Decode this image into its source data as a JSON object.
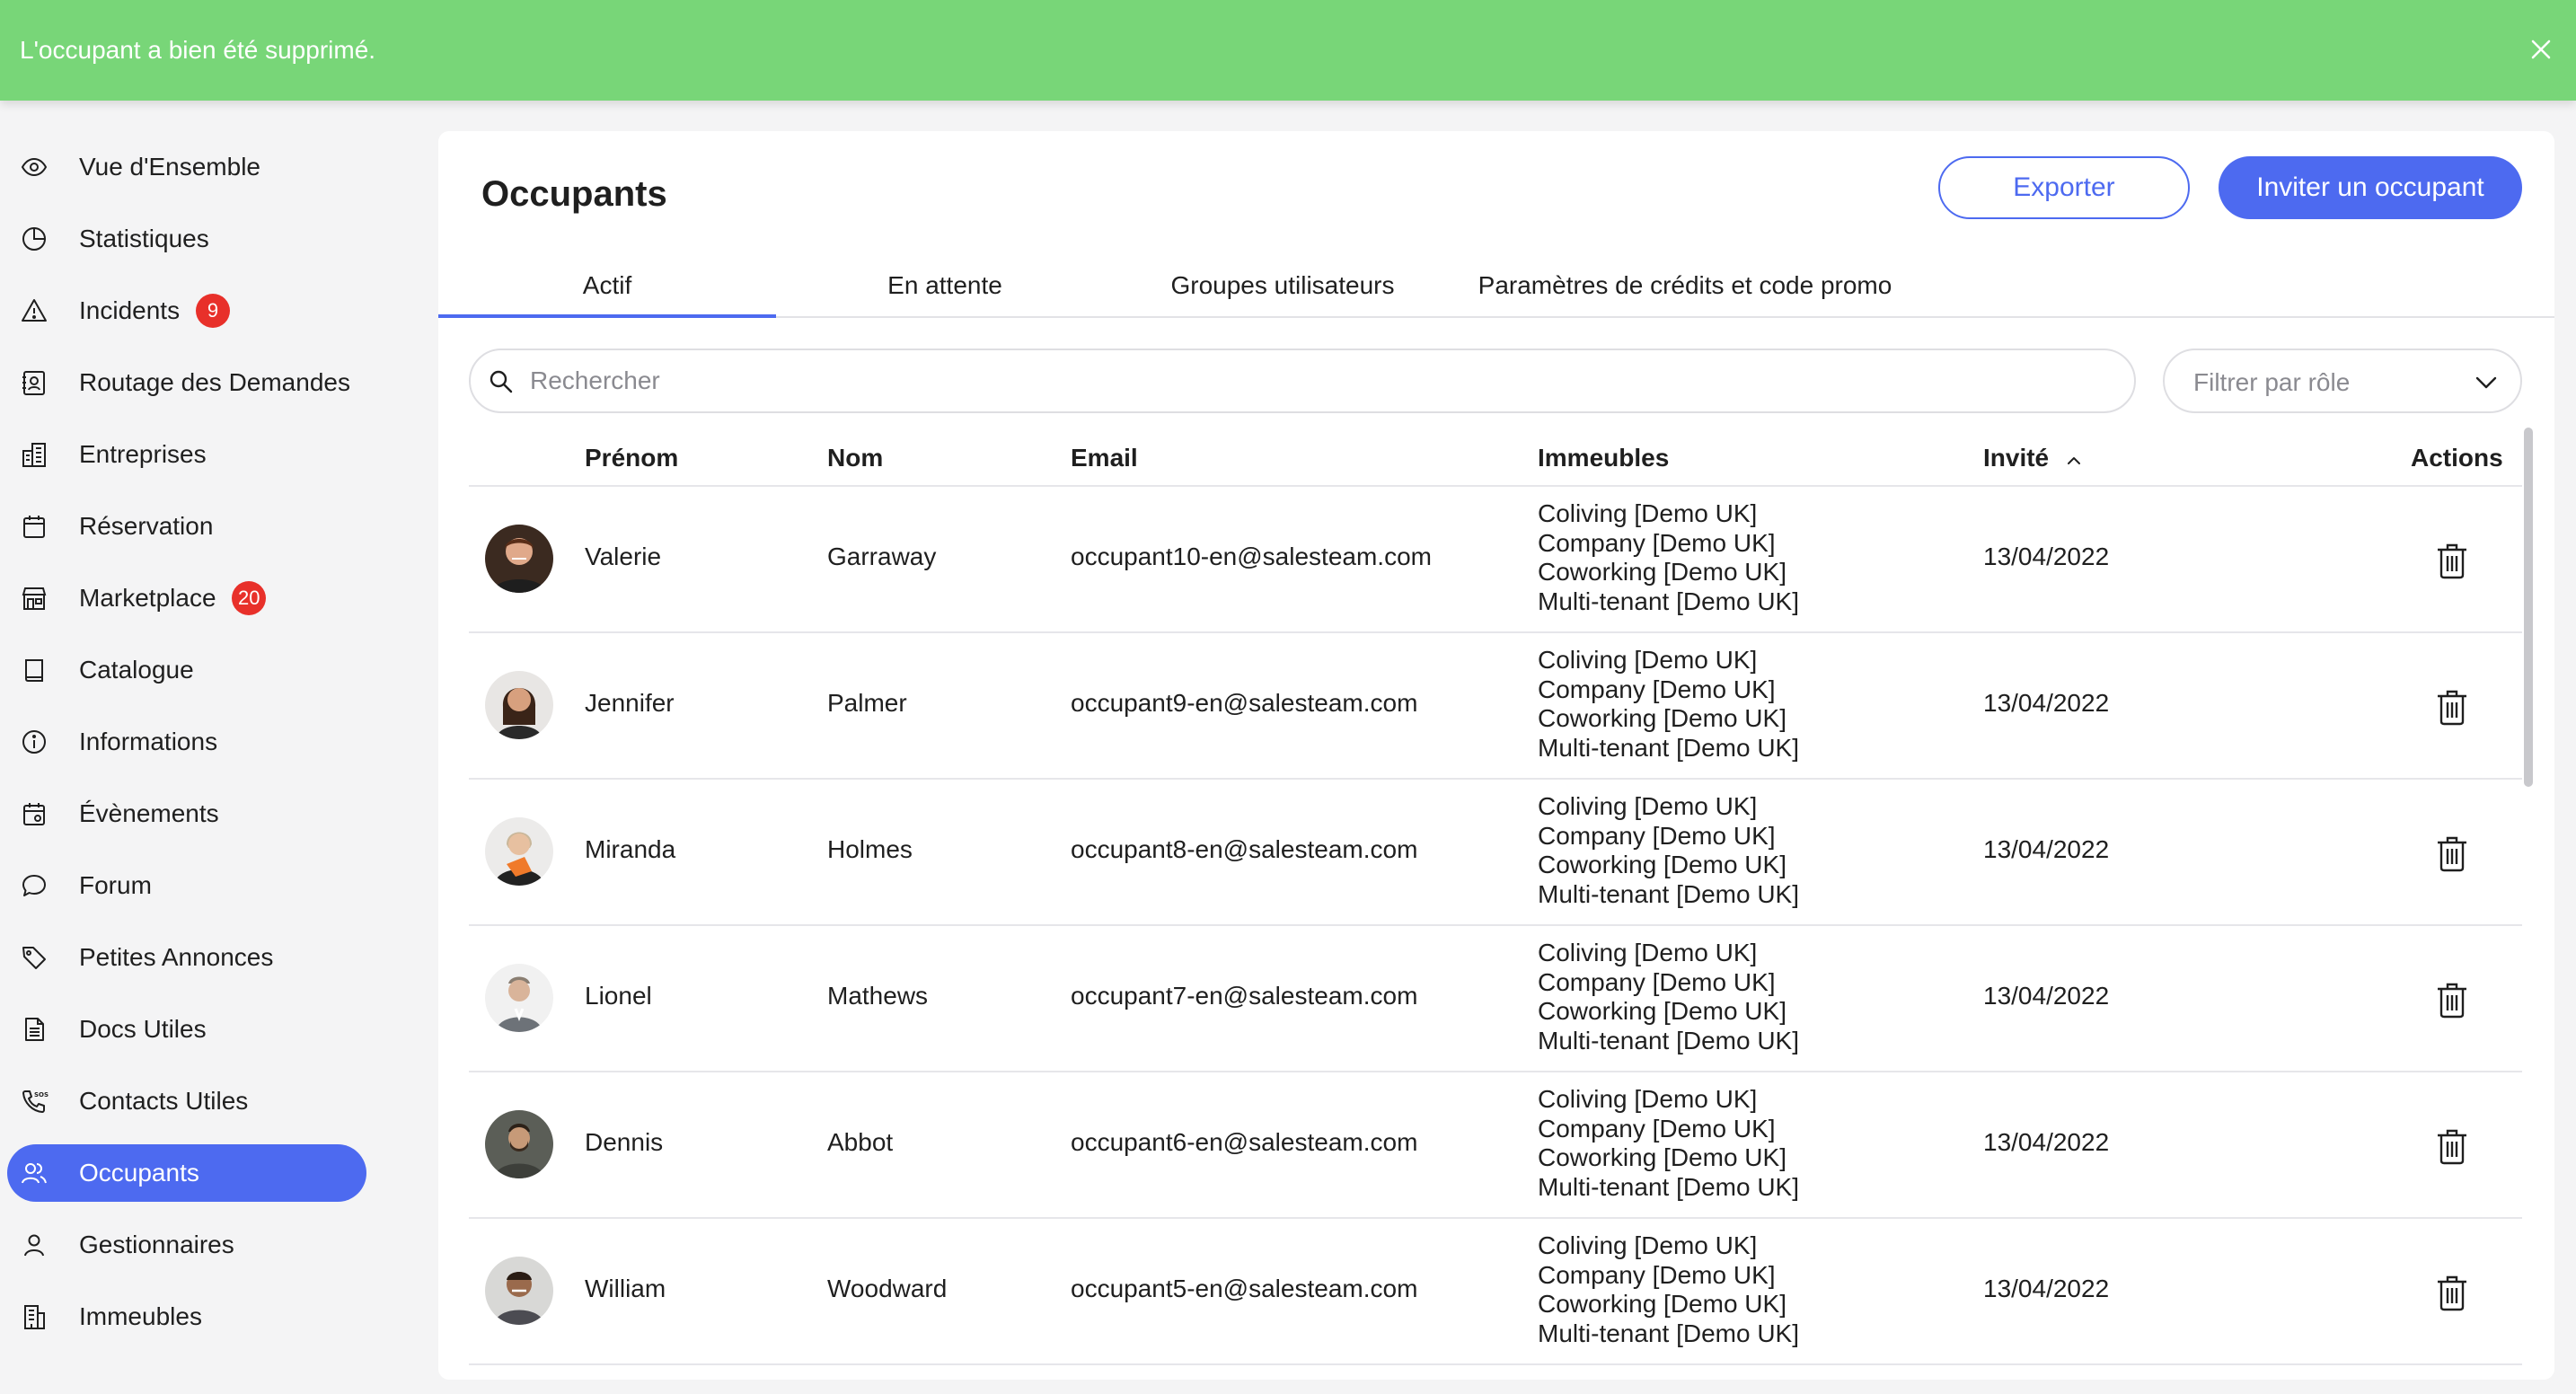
{
  "toast": {
    "message": "L'occupant a bien été supprimé.",
    "color": "#78d678"
  },
  "sidebar": {
    "accent": "#4d6af0",
    "items": [
      {
        "label": "Vue d'Ensemble",
        "icon": "eye-icon"
      },
      {
        "label": "Statistiques",
        "icon": "pie-chart-icon"
      },
      {
        "label": "Incidents",
        "icon": "warning-icon",
        "badge": "9"
      },
      {
        "label": "Routage des Demandes",
        "icon": "contact-card-icon"
      },
      {
        "label": "Entreprises",
        "icon": "city-buildings-icon"
      },
      {
        "label": "Réservation",
        "icon": "calendar-icon"
      },
      {
        "label": "Marketplace",
        "icon": "store-icon",
        "badge": "20"
      },
      {
        "label": "Catalogue",
        "icon": "book-icon"
      },
      {
        "label": "Informations",
        "icon": "info-icon"
      },
      {
        "label": "Évènements",
        "icon": "calendar-event-icon"
      },
      {
        "label": "Forum",
        "icon": "chat-bubble-icon"
      },
      {
        "label": "Petites Annonces",
        "icon": "tag-icon"
      },
      {
        "label": "Docs Utiles",
        "icon": "document-icon"
      },
      {
        "label": "Contacts Utiles",
        "icon": "sos-phone-icon"
      },
      {
        "label": "Occupants",
        "icon": "users-icon",
        "active": true
      },
      {
        "label": "Gestionnaires",
        "icon": "user-icon"
      },
      {
        "label": "Immeubles",
        "icon": "building-icon"
      }
    ]
  },
  "main": {
    "title": "Occupants",
    "export_label": "Exporter",
    "invite_label": "Inviter un occupant",
    "tabs": [
      {
        "label": "Actif",
        "active": true
      },
      {
        "label": "En attente"
      },
      {
        "label": "Groupes utilisateurs"
      },
      {
        "label": "Paramètres de crédits et code promo"
      }
    ],
    "search": {
      "placeholder": "Rechercher",
      "value": ""
    },
    "filter": {
      "label": "Filtrer par rôle"
    }
  },
  "table": {
    "columns": [
      "Prénom",
      "Nom",
      "Email",
      "Immeubles",
      "Invité",
      "Actions"
    ],
    "sort_column": "Invité",
    "sort_direction": "ascending",
    "rows": [
      {
        "first": "Valerie",
        "last": "Garraway",
        "email": "occupant10-en@salesteam.com",
        "buildings": [
          "Coliving [Demo UK]",
          "Company [Demo UK]",
          "Coworking [Demo UK]",
          "Multi-tenant [Demo UK]"
        ],
        "invited": "13/04/2022"
      },
      {
        "first": "Jennifer",
        "last": "Palmer",
        "email": "occupant9-en@salesteam.com",
        "buildings": [
          "Coliving [Demo UK]",
          "Company [Demo UK]",
          "Coworking [Demo UK]",
          "Multi-tenant [Demo UK]"
        ],
        "invited": "13/04/2022"
      },
      {
        "first": "Miranda",
        "last": "Holmes",
        "email": "occupant8-en@salesteam.com",
        "buildings": [
          "Coliving [Demo UK]",
          "Company [Demo UK]",
          "Coworking [Demo UK]",
          "Multi-tenant [Demo UK]"
        ],
        "invited": "13/04/2022"
      },
      {
        "first": "Lionel",
        "last": "Mathews",
        "email": "occupant7-en@salesteam.com",
        "buildings": [
          "Coliving [Demo UK]",
          "Company [Demo UK]",
          "Coworking [Demo UK]",
          "Multi-tenant [Demo UK]"
        ],
        "invited": "13/04/2022"
      },
      {
        "first": "Dennis",
        "last": "Abbot",
        "email": "occupant6-en@salesteam.com",
        "buildings": [
          "Coliving [Demo UK]",
          "Company [Demo UK]",
          "Coworking [Demo UK]",
          "Multi-tenant [Demo UK]"
        ],
        "invited": "13/04/2022"
      },
      {
        "first": "William",
        "last": "Woodward",
        "email": "occupant5-en@salesteam.com",
        "buildings": [
          "Coliving [Demo UK]",
          "Company [Demo UK]",
          "Coworking [Demo UK]",
          "Multi-tenant [Demo UK]"
        ],
        "invited": "13/04/2022"
      }
    ]
  }
}
